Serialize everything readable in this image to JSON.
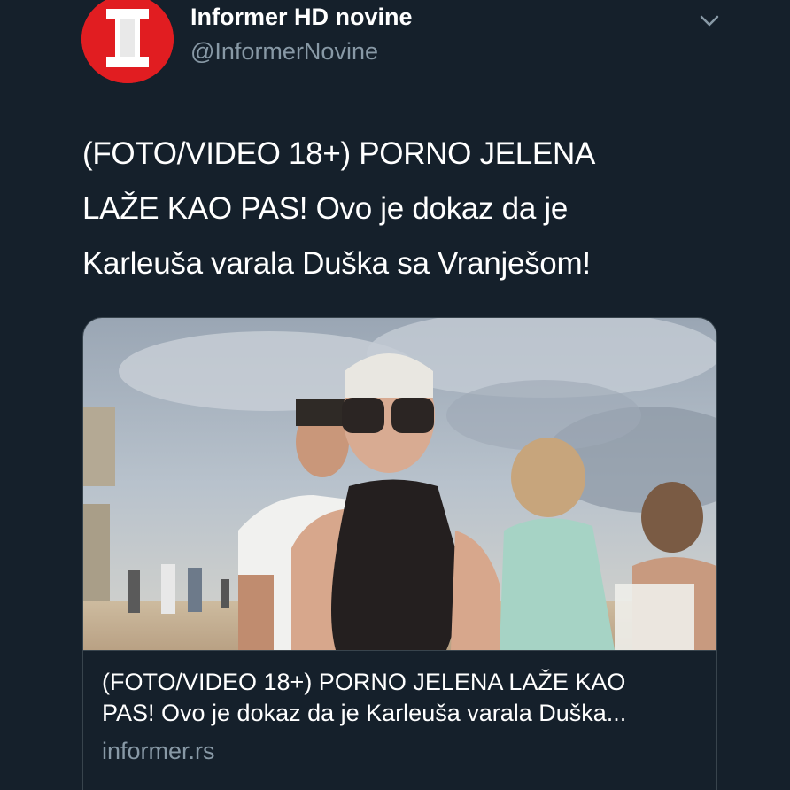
{
  "author": {
    "name": "Informer HD novine",
    "handle": "@InformerNovine",
    "avatar_letter": "I",
    "avatar_color": "#e11d21",
    "avatar_icon": "informer-logo"
  },
  "menu_icon": "chevron-down-icon",
  "tweet": {
    "lines": [
      "(FOTO/VIDEO 18+) PORNO JELENA",
      "LAŽE KAO PAS! Ovo je dokaz da je",
      "Karleuša varala Duška sa Vranješom!"
    ]
  },
  "card": {
    "title_lines": [
      "(FOTO/VIDEO 18+) PORNO JELENA LAŽE KAO",
      "PAS! Ovo je dokaz da je Karleuša varala Duška..."
    ],
    "domain": "informer.rs"
  },
  "colors": {
    "background": "#15202b",
    "secondary_text": "#8899a6",
    "border": "#38444d",
    "brand_red": "#e11d21"
  }
}
